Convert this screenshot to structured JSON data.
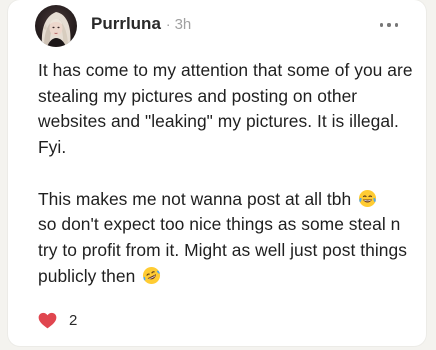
{
  "post": {
    "author": "Purrluna",
    "separator": "·",
    "time": "3h",
    "paragraphs": [
      "It has come to my attention that some of you are stealing my pictures and posting on other websites and \"leaking\" my pictures. It is illegal. Fyi.",
      "This makes me not wanna post at all tbh",
      "so don't expect too nice things as some steal n try to profit from it. Might as well just post things publicly then"
    ],
    "emojis": [
      "tears-of-joy-emoji",
      "rofl-emoji"
    ],
    "likes": "2"
  },
  "icons": {
    "more": "more-horizontal-icon",
    "like": "heart-icon"
  },
  "colors": {
    "background": "#f4f3ef",
    "card": "#ffffff",
    "heart": "#e0464f",
    "text": "#1f1f1f",
    "muted": "#a0a0a0"
  }
}
